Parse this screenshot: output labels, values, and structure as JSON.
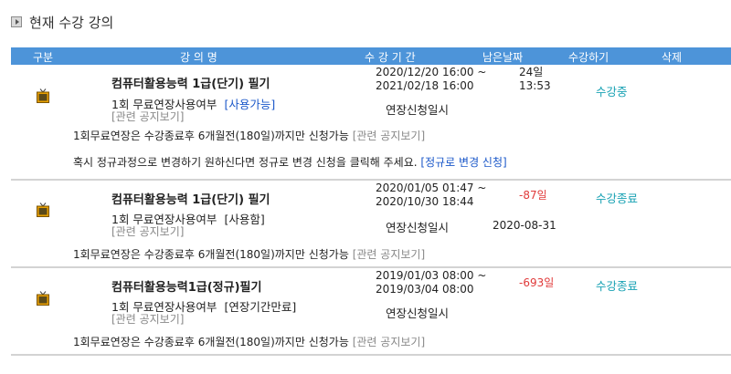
{
  "section": {
    "title": "현재 수강 강의",
    "bullet_icon": "square-arrow-icon"
  },
  "table_header": {
    "col_type": "구분",
    "col_name": "강 의 명",
    "col_period": "수 강 기 간",
    "col_remaining": "남은날짜",
    "col_status": "수강하기",
    "col_delete": "삭제"
  },
  "colors": {
    "header_bg": "#4d94d9",
    "link_blue": "#1a57c9",
    "status_teal": "#17a1b3",
    "negative_red": "#e03a3a"
  },
  "courses": [
    {
      "icon": "tv-icon",
      "title": "컴퓨터활용능력 1급(단기) 필기",
      "period_start": "2020/12/20 16:00 ~",
      "period_end": "2021/02/18 16:00",
      "remaining_days": "24일",
      "remaining_time": "13:53",
      "status": "수강중",
      "extension_label": "1회 무료연장사용여부",
      "extension_status": "[사용가능]",
      "notice_link": "[관련 공지보기]",
      "apply_label": "연장신청일시",
      "apply_date": "",
      "rule_text": "1회무료연장은 수강종료후 6개월전(180일)까지만 신청가능",
      "rule_link": "[관련 공지보기]",
      "change_text": "혹시 정규과정으로 변경하기 원하신다면 정규로 변경 신청을 클릭해 주세요.",
      "change_link": "[정규로 변경 신청]"
    },
    {
      "icon": "tv-icon",
      "title": "컴퓨터활용능력 1급(단기) 필기",
      "period_start": "2020/01/05 01:47 ~",
      "period_end": "2020/10/30 18:44",
      "remaining_days": "-87일",
      "status": "수강종료",
      "extension_label": "1회 무료연장사용여부",
      "extension_status": "[사용함]",
      "notice_link": "[관련 공지보기]",
      "apply_label": "연장신청일시",
      "apply_date": "2020-08-31",
      "rule_text": "1회무료연장은 수강종료후 6개월전(180일)까지만 신청가능",
      "rule_link": "[관련 공지보기]"
    },
    {
      "icon": "tv-icon",
      "title": "컴퓨터활용능력1급(정규)필기",
      "period_start": "2019/01/03 08:00 ~",
      "period_end": "2019/03/04 08:00",
      "remaining_days": "-693일",
      "status": "수강종료",
      "extension_label": "1회 무료연장사용여부",
      "extension_status": "[연장기간만료]",
      "notice_link": "[관련 공지보기]",
      "apply_label": "연장신청일시",
      "apply_date": "",
      "rule_text": "1회무료연장은 수강종료후 6개월전(180일)까지만 신청가능",
      "rule_link": "[관련 공지보기]"
    }
  ]
}
